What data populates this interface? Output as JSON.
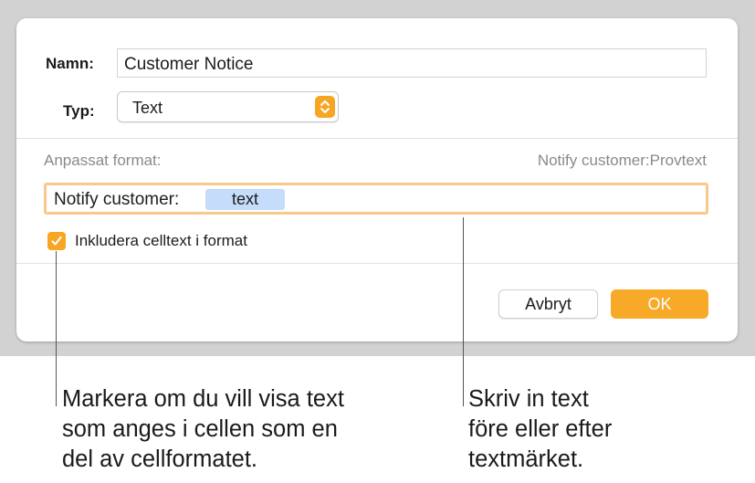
{
  "dialog": {
    "name_label": "Namn:",
    "name_value": "Customer Notice",
    "type_label": "Typ:",
    "type_value": "Text",
    "custom_format_label": "Anpassat format:",
    "preview_text": "Notify customer:Provtext",
    "format_prefix": "Notify customer:",
    "format_token": "text",
    "include_checkbox_label": "Inkludera celltext i format",
    "include_checked": true,
    "cancel_label": "Avbryt",
    "ok_label": "OK"
  },
  "callouts": {
    "left": [
      "Markera om du vill visa text",
      "som anges i cellen som en",
      "del av cellformatet."
    ],
    "right": [
      "Skriv in text",
      "före eller efter",
      "textmärket."
    ]
  },
  "colors": {
    "accent": "#f6a623",
    "token_bg": "#c5dcfa",
    "focus_ring": "#f7c98a"
  }
}
